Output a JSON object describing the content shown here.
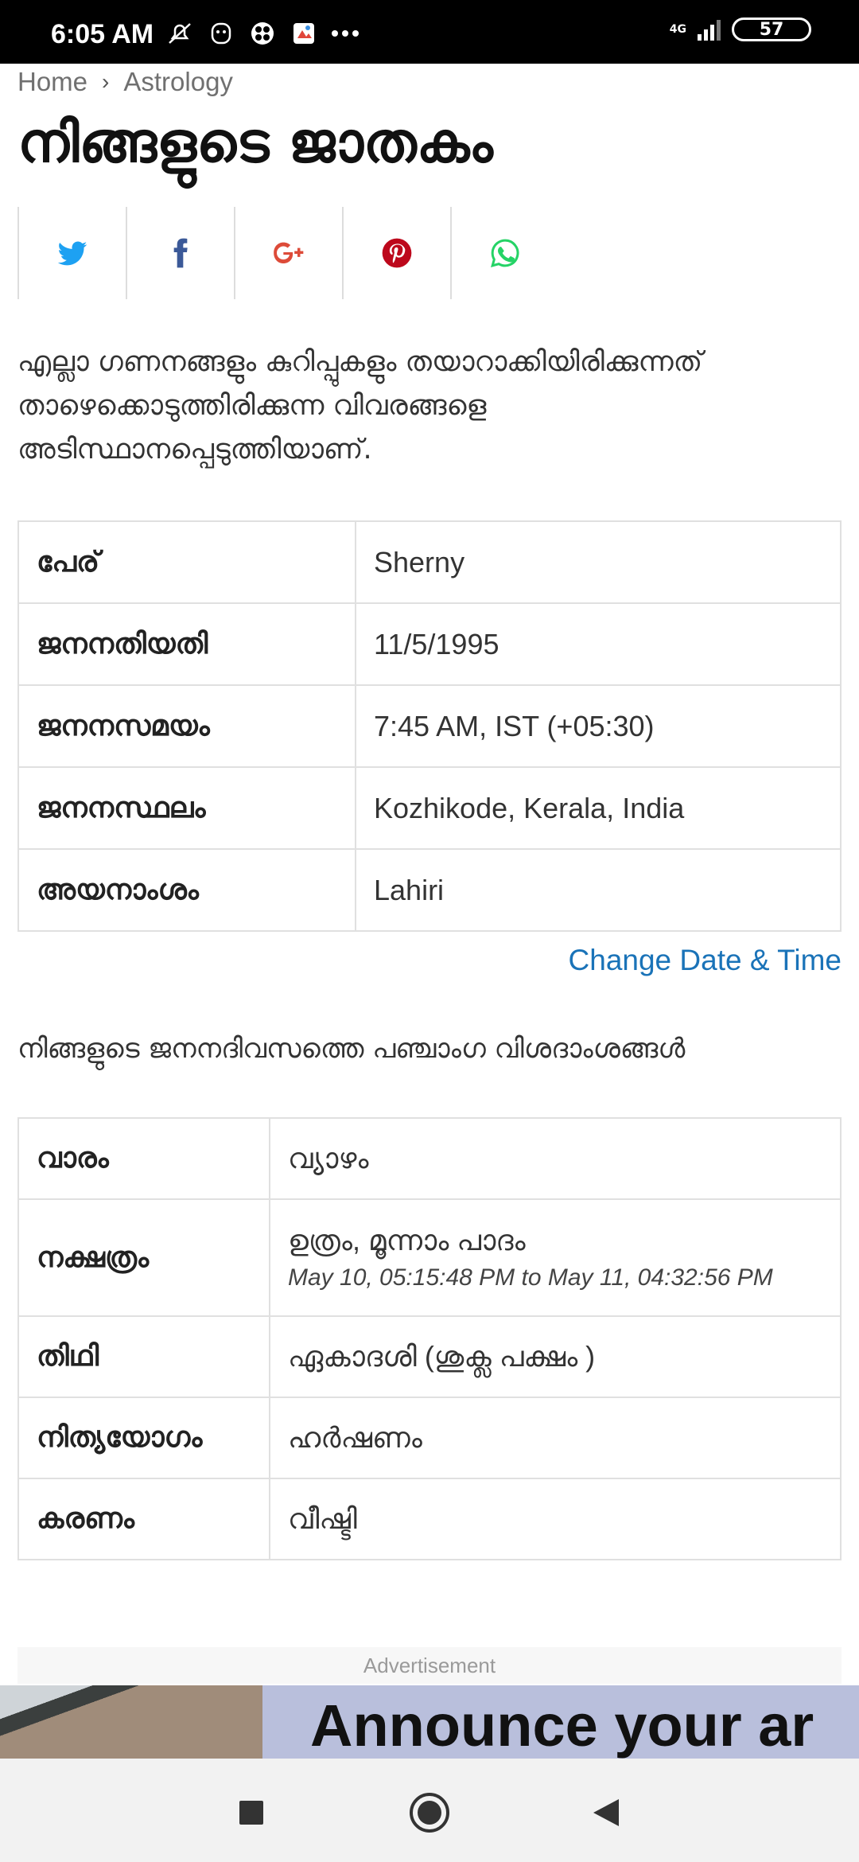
{
  "status_bar": {
    "time": "6:05 AM",
    "network": "4G",
    "battery": "57",
    "icons": [
      "mute-icon",
      "notification-icon",
      "app-icon",
      "photos-icon",
      "more-icon"
    ]
  },
  "breadcrumb": {
    "home": "Home",
    "section": "Astrology"
  },
  "title": "നിങ്ങളുടെ ജാതകം",
  "share": {
    "buttons": [
      "twitter-icon",
      "facebook-icon",
      "google-plus-icon",
      "pinterest-icon",
      "whatsapp-icon"
    ],
    "colors": {
      "twitter": "#1da1f2",
      "facebook": "#3b5998",
      "google_plus": "#dd4b39",
      "pinterest": "#bd081c",
      "whatsapp": "#25d366"
    }
  },
  "intro": "എല്ലാ ഗണനങ്ങളും കുറിപ്പുകളും തയാറാക്കിയിരിക്കുന്നത് താഴെക്കൊടുത്തിരിക്കുന്ന വിവരങ്ങളെ അടിസ്ഥാനപ്പെടുത്തിയാണ്.",
  "details": [
    {
      "label": "പേര്",
      "value": "Sherny"
    },
    {
      "label": "ജനനതിയതി",
      "value": "11/5/1995"
    },
    {
      "label": "ജനനസമയം",
      "value": "7:45 AM, IST (+05:30)"
    },
    {
      "label": "ജനനസ്ഥലം",
      "value": "Kozhikode, Kerala, India"
    },
    {
      "label": "അയനാംശം",
      "value": "Lahiri"
    }
  ],
  "change_link": "Change Date & Time",
  "panchang_heading": "നിങ്ങളുടെ ജനനദിവസത്തെ പഞ്ചാംഗ വിശദാംശങ്ങൾ",
  "panchang": [
    {
      "label": "വാരം",
      "value": "വ്യാഴം"
    },
    {
      "label": "നക്ഷത്രം",
      "value": "ഉത്രം, മൂന്നാം പാദം",
      "sub": "May 10, 05:15:48 PM to May 11, 04:32:56 PM"
    },
    {
      "label": "തിഥി",
      "value": "ഏകാദശി (ശുക്ല പക്ഷം )"
    },
    {
      "label": "നിത്യയോഗം",
      "value": "ഹർഷണം"
    },
    {
      "label": "കരണം",
      "value": "വീഷ്ടി"
    }
  ],
  "ad": {
    "label": "Advertisement",
    "banner_text": "Announce your ar"
  },
  "accent_color": "#1a73b8"
}
